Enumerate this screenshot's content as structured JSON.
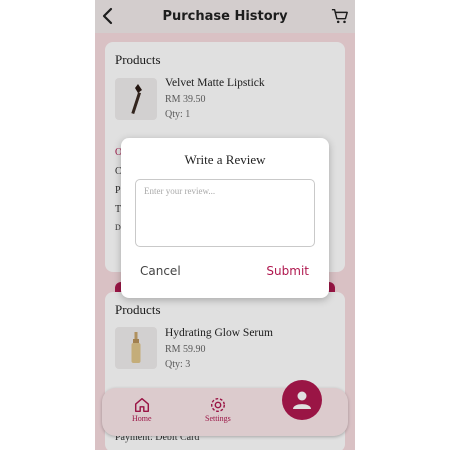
{
  "header": {
    "title": "Purchase History",
    "back_icon": "back-arrow-icon",
    "cart_icon": "cart-icon"
  },
  "orders": [
    {
      "section_label": "Products",
      "product": {
        "name": "Velvet Matte Lipstick",
        "price": "RM 39.50",
        "qty": "Qty: 1"
      },
      "partial_lines": [
        "O",
        "C",
        "P",
        "T",
        "D"
      ]
    },
    {
      "section_label": "Products",
      "product": {
        "name": "Hydrating Glow Serum",
        "price": "RM 59.90",
        "qty": "Qty: 3"
      },
      "payment": "Payment: Debit Card"
    }
  ],
  "nav": {
    "home": "Home",
    "settings": "Settings"
  },
  "review_modal": {
    "title": "Write a Review",
    "placeholder": "Enter your review...",
    "cancel": "Cancel",
    "submit": "Submit"
  },
  "colors": {
    "accent": "#b0184f",
    "background": "#f7dce0"
  }
}
